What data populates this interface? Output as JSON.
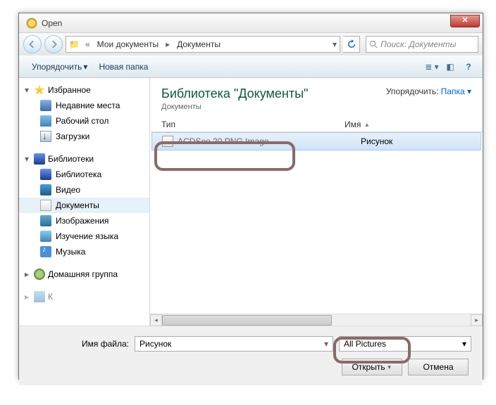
{
  "window": {
    "title": "Open"
  },
  "breadcrumb": {
    "seg1": "Мои документы",
    "seg2": "Документы"
  },
  "search": {
    "placeholder": "Поиск: Документы"
  },
  "toolbar": {
    "organize": "Упорядочить",
    "new_folder": "Новая папка"
  },
  "sidebar": {
    "favorites": {
      "label": "Избранное",
      "items": [
        "Недавние места",
        "Рабочий стол",
        "Загрузки"
      ]
    },
    "libraries": {
      "label": "Библиотеки",
      "items": [
        "Библиотека",
        "Видео",
        "Документы",
        "Изображения",
        "Изучение языка",
        "Музыка"
      ]
    },
    "homegroup": {
      "label": "Домашняя группа"
    }
  },
  "library": {
    "title": "Библиотека \"Документы\"",
    "subtitle": "Документы",
    "sort_label": "Упорядочить:",
    "sort_value": "Папка"
  },
  "columns": {
    "type": "Тип",
    "name": "Имя"
  },
  "file": {
    "type": "ACDSee 20 PNG Image",
    "name": "Рисунок"
  },
  "footer": {
    "filename_label": "Имя файла:",
    "filename_value": "Рисунок",
    "filter": "All Pictures",
    "open": "Открыть",
    "cancel": "Отмена"
  }
}
